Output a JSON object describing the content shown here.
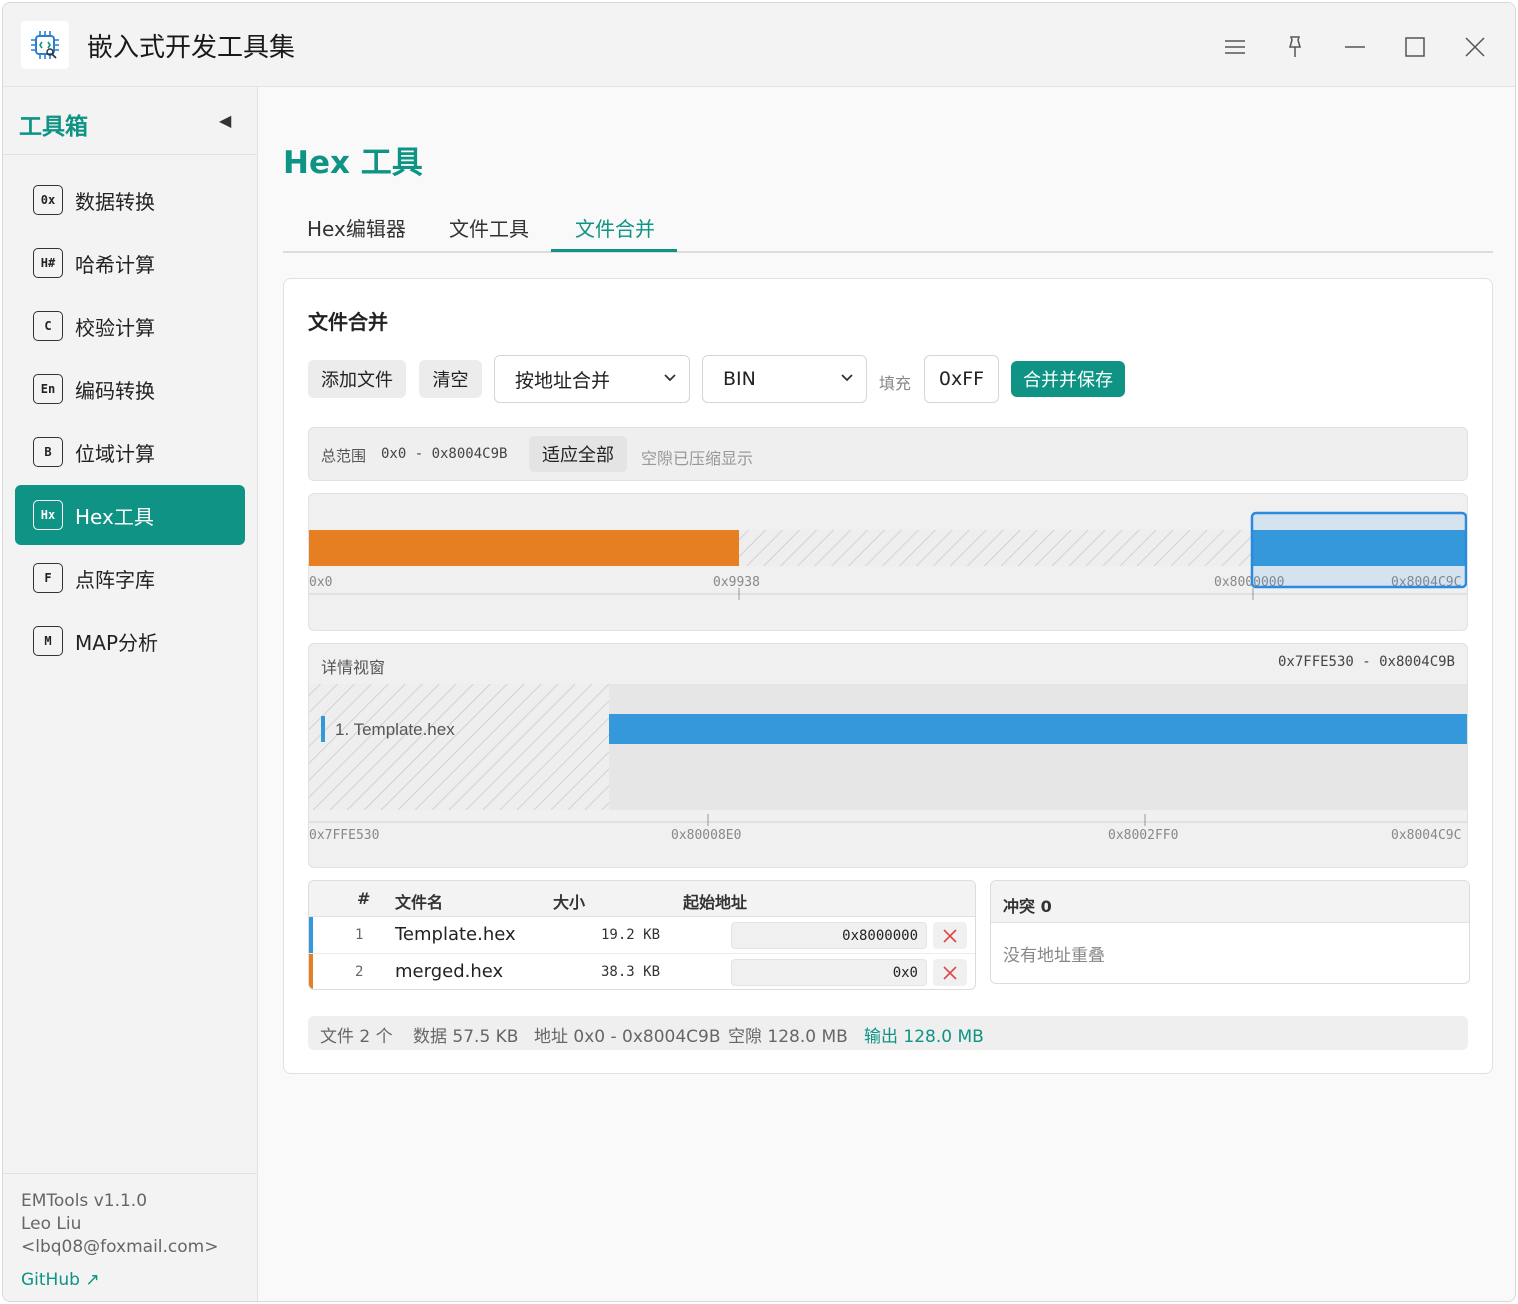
{
  "app": {
    "title": "嵌入式开发工具集",
    "accent": "#0e9384"
  },
  "window_controls": [
    "menu-icon",
    "pin-icon",
    "minimize-icon",
    "maximize-icon",
    "close-icon"
  ],
  "sidebar": {
    "title": "工具箱",
    "collapse_glyph": "◀",
    "items": [
      {
        "badge": "0x",
        "label": "数据转换"
      },
      {
        "badge": "H#",
        "label": "哈希计算"
      },
      {
        "badge": "C",
        "label": "校验计算"
      },
      {
        "badge": "En",
        "label": "编码转换"
      },
      {
        "badge": "B",
        "label": "位域计算"
      },
      {
        "badge": "Hx",
        "label": "Hex工具",
        "active": true
      },
      {
        "badge": "F",
        "label": "点阵字库"
      },
      {
        "badge": "M",
        "label": "MAP分析"
      }
    ],
    "footer": {
      "version": "EMTools v1.1.0",
      "author": "Leo Liu",
      "email": "<lbq08@foxmail.com>",
      "github": "GitHub ↗"
    }
  },
  "main": {
    "page_title": "Hex 工具",
    "tabs": [
      {
        "label": "Hex编辑器"
      },
      {
        "label": "文件工具"
      },
      {
        "label": "文件合并",
        "active": true
      }
    ]
  },
  "merge": {
    "card_title": "文件合并",
    "toolbar": {
      "add_file": "添加文件",
      "clear": "清空",
      "merge_mode": "按地址合并",
      "output_format": "BIN",
      "fill_label": "填充",
      "fill_value": "0xFF",
      "merge_save": "合并并保存"
    },
    "range": {
      "label": "总范围",
      "value": "0x0 - 0x8004C9B",
      "fit_all": "适应全部",
      "note": "空隙已压缩显示"
    },
    "overview": {
      "ticks": [
        "0x0",
        "0x9938",
        "0x8000000",
        "0x8004C9C"
      ],
      "segments": [
        {
          "file": "merged.hex",
          "color": "#e67e22"
        },
        {
          "file": "Template.hex",
          "color": "#3498db"
        }
      ]
    },
    "detail": {
      "title": "详情视窗",
      "range": "0x7FFE530 - 0x8004C9B",
      "track_label": "1. Template.hex",
      "ticks": [
        "0x7FFE530",
        "0x80008E0",
        "0x8002FF0",
        "0x8004C9C"
      ]
    },
    "table": {
      "headers": {
        "num": "#",
        "name": "文件名",
        "size": "大小",
        "start": "起始地址"
      },
      "rows": [
        {
          "num": "1",
          "name": "Template.hex",
          "size": "19.2 KB",
          "start": "0x8000000",
          "color": "#3498db"
        },
        {
          "num": "2",
          "name": "merged.hex",
          "size": "38.3 KB",
          "start": "0x0",
          "color": "#e67e22"
        }
      ]
    },
    "conflict": {
      "title": "冲突 0",
      "message": "没有地址重叠"
    },
    "status": {
      "files": "文件 2 个",
      "data": "数据 57.5 KB",
      "address": "地址 0x0 - 0x8004C9B",
      "gap": "空隙 128.0 MB",
      "output": "输出 128.0 MB"
    }
  }
}
